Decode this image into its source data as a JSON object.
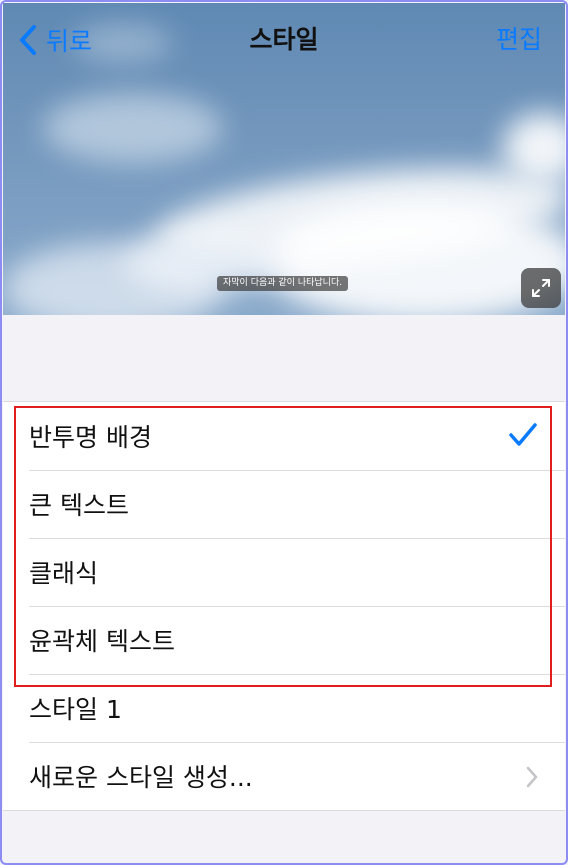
{
  "nav": {
    "back_label": "뒤로",
    "title": "스타일",
    "edit_label": "편집"
  },
  "preview": {
    "caption": "자막이 다음과 같이 나타납니다."
  },
  "styles": {
    "items": [
      {
        "label": "반투명 배경",
        "selected": true
      },
      {
        "label": "큰 텍스트"
      },
      {
        "label": "클래식"
      },
      {
        "label": "윤곽체 텍스트"
      },
      {
        "label": "스타일 1"
      },
      {
        "label": "새로운 스타일 생성..."
      }
    ]
  },
  "icons": {
    "back": "chevron-left-icon",
    "expand": "expand-icon",
    "check": "checkmark-icon",
    "disclosure": "chevron-right-icon"
  },
  "colors": {
    "accent": "#0a7aff",
    "highlight": "#e01e1e"
  }
}
